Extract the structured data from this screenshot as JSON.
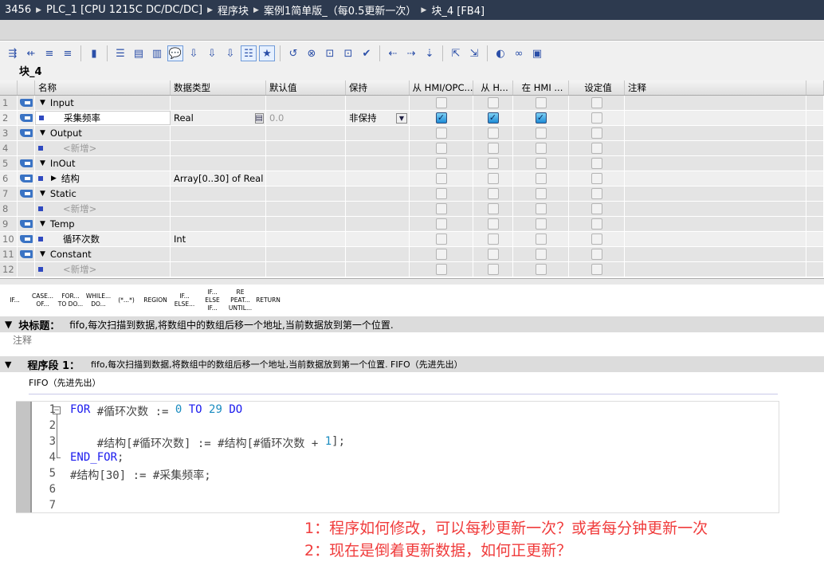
{
  "breadcrumb": [
    "3456",
    "PLC_1 [CPU 1215C DC/DC/DC]",
    "程序块",
    "案例1简单版_（每0.5更新一次）",
    "块_4 [FB4]"
  ],
  "block_name": "块_4",
  "toolbar_icons": [
    "insert-row-icon",
    "delete-row-icon",
    "insert-network-icon",
    "delete-network-icon",
    "undo-icon",
    "align-icon",
    "block-interface-icon",
    "section-icon",
    "comment-icon",
    "call-icon",
    "network-icon",
    "call2-icon",
    "list-icon",
    "favorite-icon",
    "refresh-icon",
    "close-call-icon",
    "ref-icon",
    "ref2-icon",
    "check-icon",
    "monitor-icon",
    "indent-icon",
    "outdent-icon",
    "goto-icon",
    "goto2-icon",
    "watch-icon",
    "glasses-icon",
    "plc-icon"
  ],
  "columns": [
    "",
    "",
    "名称",
    "数据类型",
    "默认值",
    "保持",
    "从 HMI/OPC...",
    "从 H...",
    "在 HMI ...",
    "设定值",
    "注释"
  ],
  "rows": [
    {
      "n": "1",
      "name": "Input",
      "section": true,
      "tag": true,
      "cbs": [
        0,
        0,
        0,
        0
      ]
    },
    {
      "n": "2",
      "name": "采集频率",
      "type": "Real",
      "def": "0.0",
      "retain": "非保持",
      "tag": true,
      "edit": true,
      "cbs": [
        1,
        1,
        1,
        0
      ]
    },
    {
      "n": "3",
      "name": "Output",
      "section": true,
      "tag": true,
      "cbs": [
        0,
        0,
        0,
        0
      ]
    },
    {
      "n": "4",
      "name": "<新增>",
      "muted": true,
      "cbs": [
        0,
        0,
        0,
        0
      ]
    },
    {
      "n": "5",
      "name": "InOut",
      "section": true,
      "tag": true,
      "cbs": [
        0,
        0,
        0,
        0
      ]
    },
    {
      "n": "6",
      "name": "结构",
      "type": "Array[0..30] of Real",
      "tag": true,
      "expand": true,
      "cbs": [
        0,
        0,
        0,
        0
      ]
    },
    {
      "n": "7",
      "name": "Static",
      "section": true,
      "tag": true,
      "cbs": [
        0,
        0,
        0,
        0
      ]
    },
    {
      "n": "8",
      "name": "<新增>",
      "muted": true,
      "cbs": [
        0,
        0,
        0,
        0
      ]
    },
    {
      "n": "9",
      "name": "Temp",
      "section": true,
      "tag": true,
      "cbs": [
        0,
        0,
        0,
        0
      ]
    },
    {
      "n": "10",
      "name": "循环次数",
      "type": "Int",
      "tag": true,
      "cbs": [
        0,
        0,
        0,
        0
      ]
    },
    {
      "n": "11",
      "name": "Constant",
      "section": true,
      "tag": true,
      "cbs": [
        0,
        0,
        0,
        0
      ]
    },
    {
      "n": "12",
      "name": "<新增>",
      "muted": true,
      "cbs": [
        0,
        0,
        0,
        0
      ]
    }
  ],
  "snippets": [
    "IF...",
    "CASE... OF...",
    "FOR... TO DO...",
    "WHILE... DO...",
    "(*...*)",
    "REGION",
    "IF... ELSE...",
    "IF... ELSE IF...",
    "RE PEAT... UNTIL...",
    "RETURN"
  ],
  "block_title": {
    "label": "块标题：",
    "text": "fifo,每次扫描到数据,将数组中的数组后移一个地址,当前数据放到第一个位置.",
    "comment": "注释"
  },
  "network": {
    "label": "程序段 1：",
    "text": "fifo,每次扫描到数据,将数组中的数组后移一个地址,当前数据放到第一个位置.  FIFO（先进先出）",
    "comment": "FIFO（先进先出）"
  },
  "code": [
    [
      [
        "kw",
        "FOR "
      ],
      [
        "",
        "#循环次数 := "
      ],
      [
        "num",
        "0"
      ],
      [
        "kw",
        " TO "
      ],
      [
        "num",
        "29"
      ],
      [
        "kw",
        " DO"
      ]
    ],
    [],
    [
      [
        "",
        "    #结构[#循环次数] := #结构[#循环次数 + "
      ],
      [
        "num",
        "1"
      ],
      [
        "",
        "];"
      ]
    ],
    [
      [
        "kw",
        "END_FOR"
      ],
      [
        "",
        ";"
      ]
    ],
    [
      [
        "",
        "#结构[30] := #采集频率;"
      ]
    ],
    [],
    []
  ],
  "questions": [
    "1：程序如何修改，可以每秒更新一次？或者每分钟更新一次",
    "2：现在是倒着更新数据，如何正更新？"
  ]
}
